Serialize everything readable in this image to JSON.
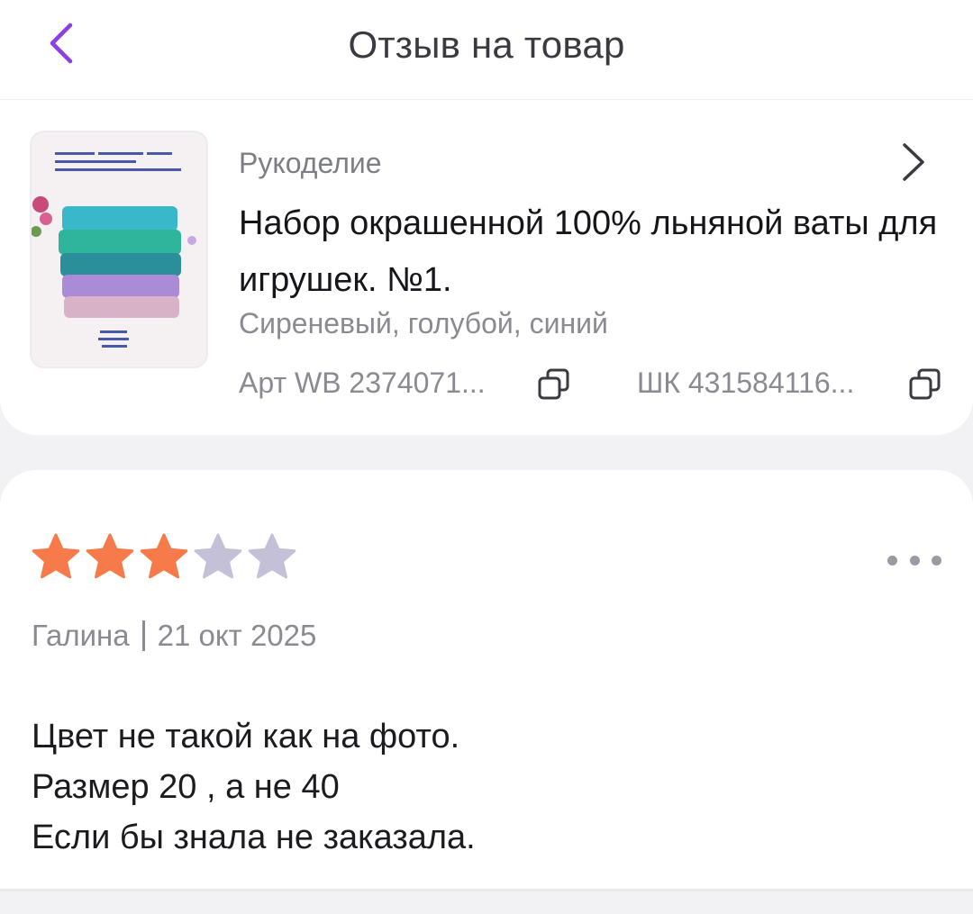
{
  "header": {
    "title": "Отзыв на товар",
    "back_icon": "chevron-left-icon",
    "accent_color": "#8b3fe0"
  },
  "product": {
    "category": "Рукоделие",
    "name": "Набор окрашенной 100% льняной ваты для игрушек. №1.",
    "colors": "Сиреневый, голубой, синий",
    "article": "Арт WB 2374071...",
    "barcode": "ШК 431584116...",
    "image_icon": "product-photo"
  },
  "review": {
    "rating": 3,
    "max_rating": 5,
    "star_active_color": "#f67a4a",
    "star_inactive_color": "#c4c0d8",
    "author": "Галина",
    "date": "21 окт 2025",
    "text_lines": [
      "Цвет не такой как на фото.",
      "Размер 20 , а не 40",
      "Если бы знала не заказала."
    ]
  }
}
